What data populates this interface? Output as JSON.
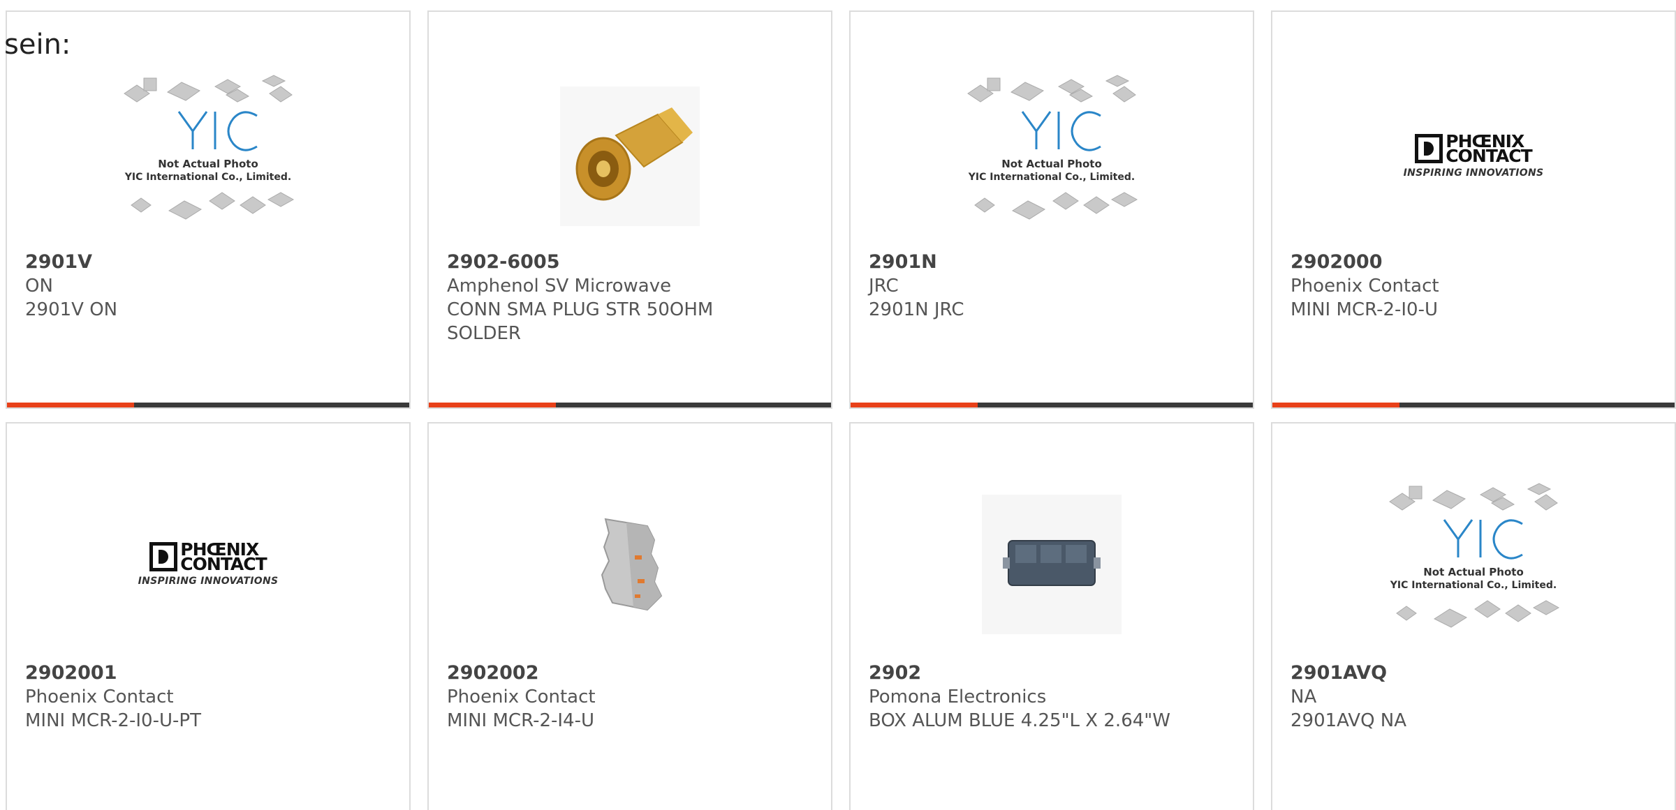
{
  "intro_text": "sein:",
  "placeholder": {
    "line1": "Not Actual Photo",
    "line2": "YIC International Co., Limited.",
    "logo": "YIC"
  },
  "phoenix_logo": {
    "line1": "PHŒNIX",
    "line2": "CONTACT",
    "tagline": "INSPIRING INNOVATIONS"
  },
  "colors": {
    "accent": "#e8411a",
    "bar": "#3a3a3a",
    "text": "#555555",
    "border": "#dcdcdc"
  },
  "products": [
    {
      "part": "2901V",
      "maker": "ON",
      "desc": "2901V ON",
      "image": "placeholder-icon"
    },
    {
      "part": "2902-6005",
      "maker": "Amphenol SV Microwave",
      "desc": "CONN SMA PLUG STR 50OHM SOLDER",
      "image": "sma-connector-icon"
    },
    {
      "part": "2901N",
      "maker": "JRC",
      "desc": "2901N JRC",
      "image": "placeholder-icon"
    },
    {
      "part": "2902000",
      "maker": "Phoenix Contact",
      "desc": "MINI MCR-2-I0-U",
      "image": "phoenix-logo"
    },
    {
      "part": "2902001",
      "maker": "Phoenix Contact",
      "desc": "MINI MCR-2-I0-U-PT",
      "image": "phoenix-logo"
    },
    {
      "part": "2902002",
      "maker": "Phoenix Contact",
      "desc": "MINI MCR-2-I4-U",
      "image": "din-module-icon"
    },
    {
      "part": "2902",
      "maker": "Pomona Electronics",
      "desc": "BOX ALUM BLUE 4.25\"L X 2.64\"W",
      "image": "enclosure-box-icon"
    },
    {
      "part": "2901AVQ",
      "maker": "NA",
      "desc": "2901AVQ NA",
      "image": "placeholder-icon"
    }
  ]
}
